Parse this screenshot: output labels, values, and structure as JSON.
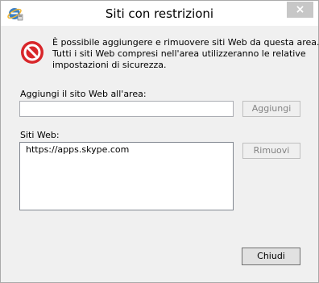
{
  "window": {
    "title": "Siti con restrizioni",
    "close_glyph": "×"
  },
  "info": {
    "icon": "no-entry-icon",
    "lines": [
      "È possibile aggiungere e rimuovere siti Web da questa area.",
      "Tutti i siti Web compresi nell'area utilizzeranno le relative",
      "impostazioni di sicurezza."
    ]
  },
  "add_site": {
    "label": "Aggiungi il sito Web all'area:",
    "value": "",
    "button_label": "Aggiungi"
  },
  "websites": {
    "label": "Siti Web:",
    "items": [
      "https://apps.skype.com"
    ],
    "remove_button_label": "Rimuovi"
  },
  "footer": {
    "close_button_label": "Chiudi"
  },
  "colors": {
    "warning_red": "#d8262a",
    "window_bg": "#f0f0f0"
  }
}
